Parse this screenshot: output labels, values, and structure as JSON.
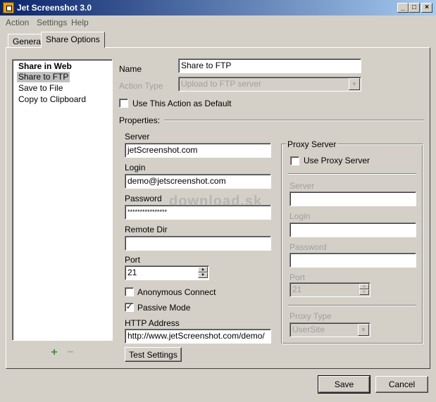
{
  "window": {
    "title": "Jet Screenshot 3.0",
    "min_glyph": "_",
    "max_glyph": "□",
    "close_glyph": "×"
  },
  "menu": [
    "Action",
    "Settings",
    "Help"
  ],
  "tabs": [
    {
      "label": "General",
      "active": false
    },
    {
      "label": "Share Options",
      "active": true
    }
  ],
  "actions_list": [
    {
      "label": "Share in Web",
      "bold": true,
      "selected": false
    },
    {
      "label": "Share to FTP",
      "bold": false,
      "selected": true
    },
    {
      "label": "Save to File",
      "bold": false,
      "selected": false
    },
    {
      "label": "Copy to Clipboard",
      "bold": false,
      "selected": false
    }
  ],
  "list_buttons": {
    "add": "+",
    "remove": "−"
  },
  "form": {
    "name_label": "Name",
    "name_value": "Share to FTP",
    "action_type_label": "Action Type",
    "action_type_value": "Upload to FTP server",
    "default_checkbox_label": "Use This Action as Default",
    "default_checked": false,
    "properties_label": "Properties:"
  },
  "ftp": {
    "server_label": "Server",
    "server_value": "jetScreenshot.com",
    "login_label": "Login",
    "login_value": "demo@jetscreenshot.com",
    "password_label": "Password",
    "password_value": "****************",
    "remote_dir_label": "Remote Dir",
    "remote_dir_value": "",
    "port_label": "Port",
    "port_value": "21",
    "anonymous_label": "Anonymous Connect",
    "anonymous_checked": false,
    "passive_label": "Passive Mode",
    "passive_checked": true,
    "http_label": "HTTP Address",
    "http_value": "http://www.jetScreenshot.com/demo/",
    "test_button": "Test Settings"
  },
  "proxy": {
    "group_title": "Proxy Server",
    "use_proxy_label": "Use Proxy Server",
    "use_proxy_checked": false,
    "server_label": "Server",
    "login_label": "Login",
    "password_label": "Password",
    "port_label": "Port",
    "port_value": "21",
    "type_label": "Proxy Type",
    "type_value": "UserSite"
  },
  "footer": {
    "save": "Save",
    "cancel": "Cancel"
  },
  "watermark": "download.sk"
}
